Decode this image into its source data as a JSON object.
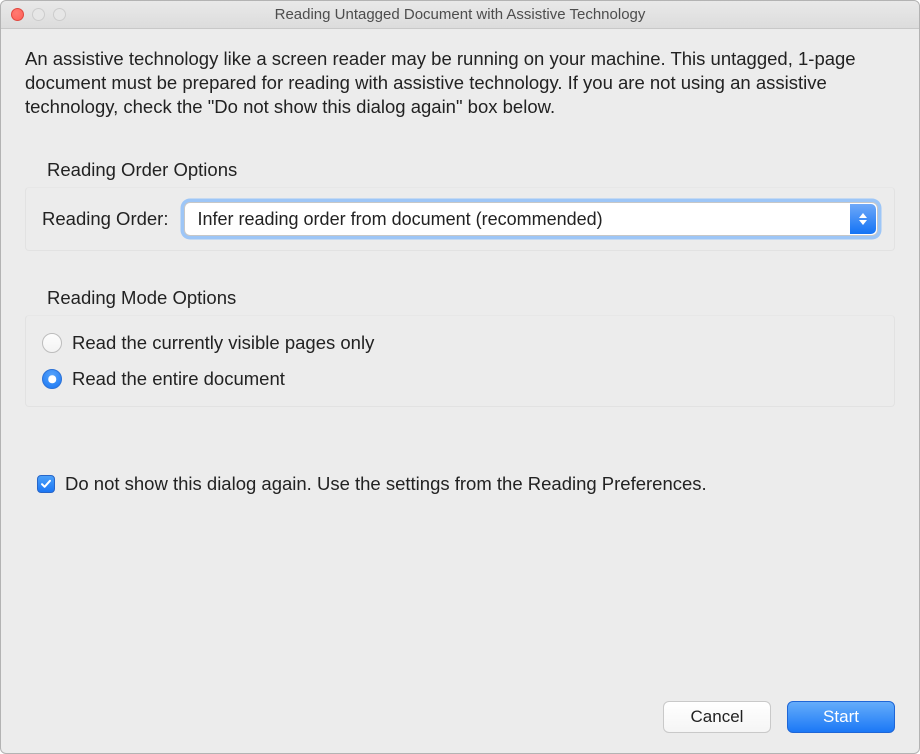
{
  "title": "Reading Untagged Document with Assistive Technology",
  "description": "An assistive technology like a screen reader may be running on your machine. This untagged, 1-page document must be prepared for reading with assistive technology. If you are not using an assistive technology, check the \"Do not show this dialog again\" box below.",
  "reading_order": {
    "section_label": "Reading Order Options",
    "label": "Reading Order:",
    "selected": "Infer reading order from document (recommended)"
  },
  "reading_mode": {
    "section_label": "Reading Mode Options",
    "option_visible": "Read the currently visible pages only",
    "option_entire": "Read the entire document"
  },
  "checkbox_label": "Do not show this dialog again. Use the settings from the Reading Preferences.",
  "buttons": {
    "cancel": "Cancel",
    "start": "Start"
  }
}
